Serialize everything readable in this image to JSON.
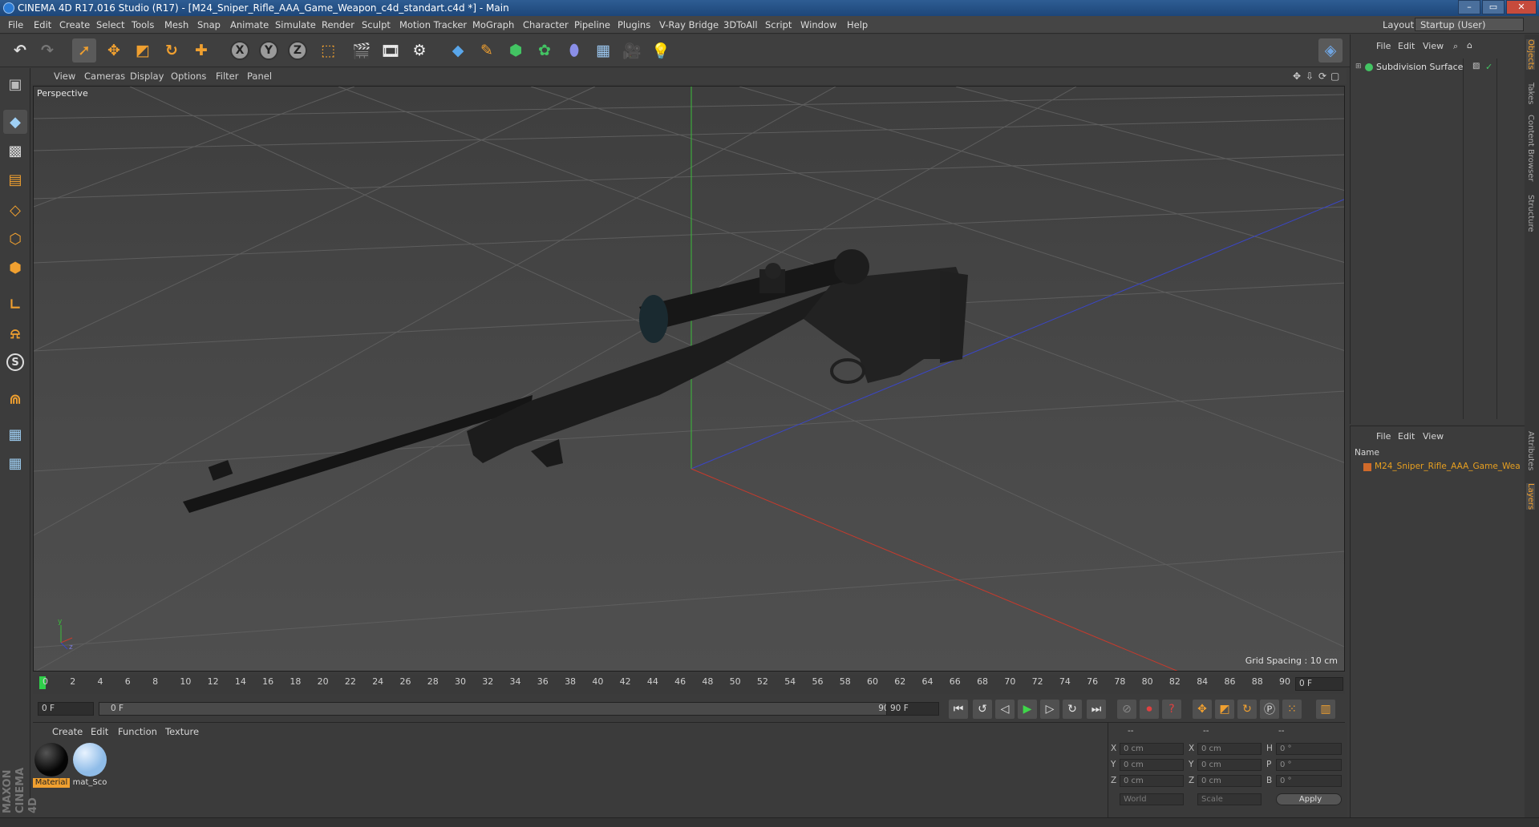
{
  "window": {
    "title": "CINEMA 4D R17.016 Studio (R17) - [M24_Sniper_Rifle_AAA_Game_Weapon_c4d_standart.c4d *] - Main",
    "layout_label": "Layout:",
    "layout_value": "Startup (User)"
  },
  "menu": [
    "File",
    "Edit",
    "Create",
    "Select",
    "Tools",
    "Mesh",
    "Snap",
    "Animate",
    "Simulate",
    "Render",
    "Sculpt",
    "Motion Tracker",
    "MoGraph",
    "Character",
    "Pipeline",
    "Plugins",
    "V-Ray Bridge",
    "3DToAll",
    "Script",
    "Window",
    "Help"
  ],
  "toolbar": {
    "undo_icon": "undo-icon",
    "axis_labels": [
      "X",
      "Y",
      "Z"
    ]
  },
  "viewport": {
    "menu": [
      "View",
      "Cameras",
      "Display",
      "Options",
      "Filter",
      "Panel"
    ],
    "label": "Perspective",
    "grid_spacing": "Grid Spacing : 10 cm",
    "axis_y": "y",
    "axis_z": "z"
  },
  "timeline": {
    "ticks": [
      "0",
      "2",
      "4",
      "6",
      "8",
      "10",
      "12",
      "14",
      "16",
      "18",
      "20",
      "22",
      "24",
      "26",
      "28",
      "30",
      "32",
      "34",
      "36",
      "38",
      "40",
      "42",
      "44",
      "46",
      "48",
      "50",
      "52",
      "54",
      "56",
      "58",
      "60",
      "62",
      "64",
      "66",
      "68",
      "70",
      "72",
      "74",
      "76",
      "78",
      "80",
      "82",
      "84",
      "86",
      "88",
      "90"
    ],
    "current_frame": "0 F",
    "start_field": "0 F",
    "range_start": "0 F",
    "range_end": "90 F",
    "end_field": "90 F"
  },
  "materials": {
    "menu": [
      "Create",
      "Edit",
      "Function",
      "Texture"
    ],
    "items": [
      {
        "label": "Material",
        "color": "#0f0f0f",
        "selected": true
      },
      {
        "label": "mat_Sco",
        "color": "#a9cdf3",
        "selected": false
      }
    ]
  },
  "coords": {
    "header": [
      "--",
      "--",
      "--"
    ],
    "rows": [
      {
        "a": "X",
        "av": "0 cm",
        "b": "X",
        "bv": "0 cm",
        "c": "H",
        "cv": "0 °"
      },
      {
        "a": "Y",
        "av": "0 cm",
        "b": "Y",
        "bv": "0 cm",
        "c": "P",
        "cv": "0 °"
      },
      {
        "a": "Z",
        "av": "0 cm",
        "b": "Z",
        "bv": "0 cm",
        "c": "B",
        "cv": "0 °"
      }
    ],
    "world": "World",
    "scale": "Scale",
    "apply": "Apply"
  },
  "objects": {
    "menu": [
      "File",
      "Edit",
      "View"
    ],
    "items": [
      "Subdivision Surface"
    ]
  },
  "layers": {
    "menu": [
      "File",
      "Edit",
      "View"
    ],
    "name_header": "Name",
    "items": [
      "M24_Sniper_Rifle_AAA_Game_Wea"
    ]
  },
  "side_tabs": [
    "Objects",
    "Takes",
    "Content Browser",
    "Structure",
    "Attributes",
    "Layers"
  ],
  "branding": "MAXON CINEMA 4D",
  "colors": {
    "accent_orange": "#f0a030",
    "layer_text": "#e8a020",
    "axis_x": "#c83a2c",
    "axis_y": "#3bbd3b",
    "axis_z": "#3a46c8"
  }
}
